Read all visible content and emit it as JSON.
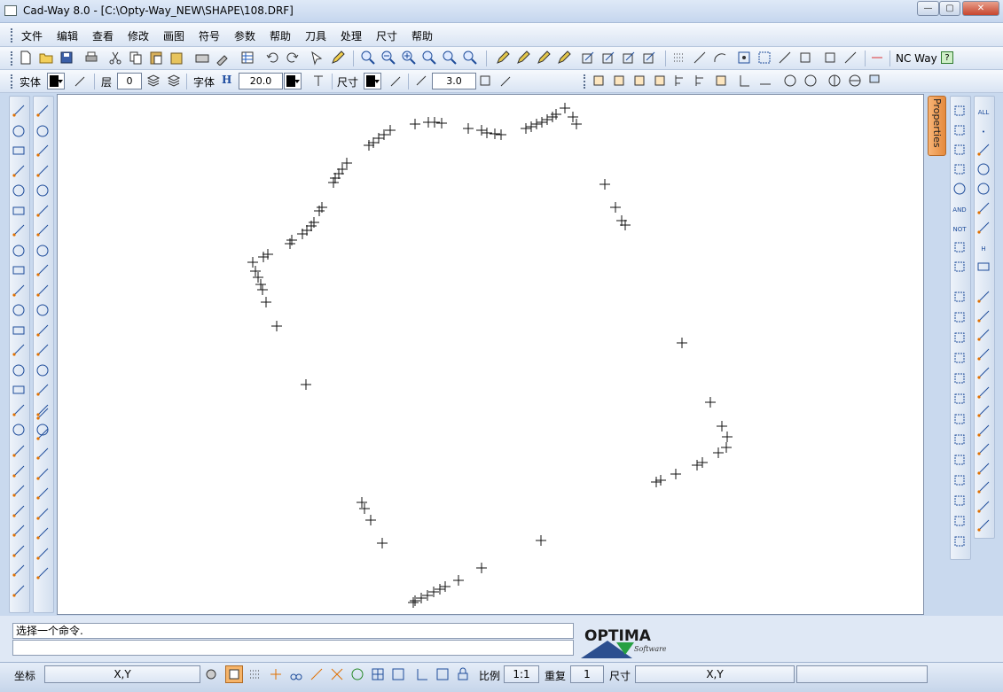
{
  "window": {
    "title": "Cad-Way 8.0 - [C:\\Opty-Way_NEW\\SHAPE\\108.DRF]",
    "min": "—",
    "max": "▢",
    "close": "✕"
  },
  "menu": [
    "文件",
    "编辑",
    "查看",
    "修改",
    "画图",
    "符号",
    "参数",
    "帮助",
    "刀具",
    "处理",
    "尺寸",
    "帮助"
  ],
  "toolbar1": {
    "ncway_label": "NC Way",
    "help": "?"
  },
  "toolbar2": {
    "entity_label": "实体",
    "layer_label": "层",
    "layer_value": "0",
    "font_label": "字体",
    "font_h": "H",
    "font_size": "20.0",
    "dim_label": "尺寸",
    "dim_value": "3.0"
  },
  "properties_tab": "Properties",
  "command": {
    "prompt": "选择一个命令.",
    "input": ""
  },
  "logo": {
    "text": "OPTIMA",
    "sub": "Software"
  },
  "status": {
    "coord_label": "坐标",
    "coord_value": "X,Y",
    "scale_label": "比例",
    "scale_value": "1:1",
    "repeat_label": "重复",
    "repeat_value": "1",
    "size_label": "尺寸",
    "size_value": "X,Y"
  },
  "right_tool_labels": {
    "all": "ALL",
    "and": "AND",
    "not": "NOT",
    "h": "H"
  }
}
